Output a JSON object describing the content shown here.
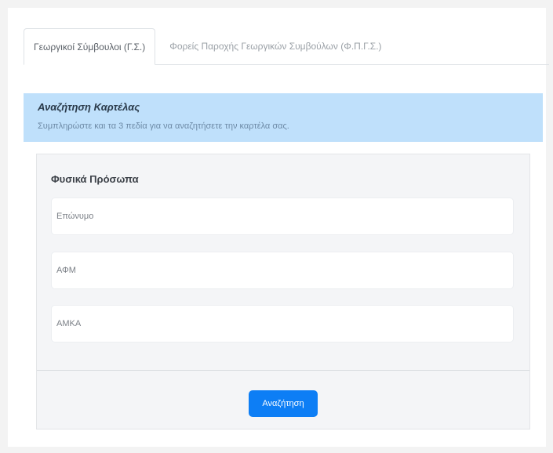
{
  "tabs": [
    {
      "label": "Γεωργικοί Σύμβουλοι (Γ.Σ.)",
      "active": true
    },
    {
      "label": "Φορείς Παροχής Γεωργικών Συμβούλων (Φ.Π.Γ.Σ.)",
      "active": false
    }
  ],
  "banner": {
    "title": "Αναζήτηση Καρτέλας",
    "text": "Συμπληρώστε και τα 3 πεδία για να αναζητήσετε την καρτέλα σας."
  },
  "form": {
    "section_title": "Φυσικά Πρόσωπα",
    "fields": [
      {
        "placeholder": "Επώνυμο",
        "value": ""
      },
      {
        "placeholder": "ΑΦΜ",
        "value": ""
      },
      {
        "placeholder": "ΑΜΚΑ",
        "value": ""
      }
    ],
    "submit_label": "Αναζήτηση"
  },
  "colors": {
    "banner_bg": "#bfe0fb",
    "primary_button": "#0d7ef5",
    "card_bg": "#f4f5f7"
  }
}
